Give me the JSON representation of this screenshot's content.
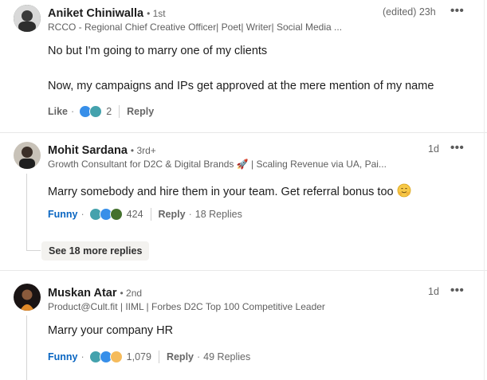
{
  "comments": [
    {
      "name": "Aniket Chiniwalla",
      "degree": "• 1st",
      "headline": "RCCO - Regional Chief Creative Officer| Poet| Writer| Social Media ...",
      "time": "(edited) 23h",
      "text_lines": [
        "No but I'm going to marry one of my clients",
        "Now, my campaigns and IPs get approved at the mere mention of my name"
      ],
      "reaction_label": "Like",
      "reaction_count": "2",
      "reply_label": "Reply"
    },
    {
      "name": "Mohit Sardana",
      "degree": "• 3rd+",
      "headline": "Growth Consultant for D2C & Digital Brands 🚀 | Scaling Revenue via UA, Pai...",
      "time": "1d",
      "text": "Marry somebody and hire them in your team. Get referral bonus too",
      "reaction_label": "Funny",
      "reaction_count": "424",
      "reply_label": "Reply",
      "replies_label": "18 Replies",
      "see_more_label": "See 18 more replies"
    },
    {
      "name": "Muskan Atar",
      "degree": "• 2nd",
      "headline": "Product@Cult.fit | IIML | Forbes D2C Top 100 Competitive Leader",
      "time": "1d",
      "text": "Marry your company HR",
      "reaction_label": "Funny",
      "reaction_count": "1,079",
      "reply_label": "Reply",
      "replies_label": "49 Replies"
    }
  ],
  "more_icon": "•••",
  "icons": [
    "overflow-menu-icon",
    "like-reaction-icon",
    "funny-reaction-icon",
    "celebrate-reaction-icon",
    "insightful-reaction-icon",
    "hugging-face-emoji"
  ],
  "colors": {
    "link_blue": "#0a66c2",
    "like_blue": "#378fe9",
    "funny_teal": "#44a2ad",
    "celebrate_green": "#44712e"
  }
}
